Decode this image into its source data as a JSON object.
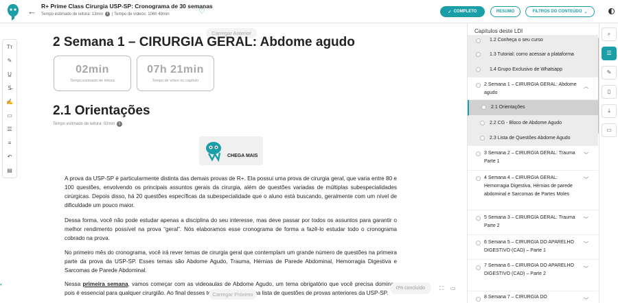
{
  "header": {
    "title": "R+ Prime Class Cirurgia USP-SP: Cronograma de 30 semanas",
    "read_time": "Tempo estimado de leitura: 13min",
    "video_time": "| Tempo de vídeos: 106h 49min",
    "complete_label": "COMPLETO",
    "resumo_label": "RESUMO",
    "filtros_label": "FILTROS DO CONTEÚDO"
  },
  "content": {
    "load_prev": "Carregar Anterior",
    "load_next": "Carregar Próximo",
    "h1": "2 Semana 1 – CIRURGIA GERAL: Abdome agudo",
    "stat1_value": "02min",
    "stat1_label": "Tempo estimado de leitura",
    "stat2_value": "07h 21min",
    "stat2_label": "Tempo de vídeo no capítulo",
    "h2": "2.1 Orientações",
    "h2_readtime": "Tempo estimado de leitura: 02min",
    "banner_text": "CHEGA MAIS",
    "p1": "A prova da USP-SP é particularmente distinta das demais provas de R+. Ela possui uma prova de cirurgia geral, que varia entre 80 e 100 questões, envolvendo os principais assuntos gerais da cirurgia, além de questões variadas de múltiplas subespecialidades cirúrgicas. Depois disso, há 20 questões específicas da subespecialidade que o aluno está buscando, geralmente com um nível de dificuldade um pouco maior.",
    "p2": "Dessa forma, você não pode estudar apenas a disciplina do seu interesse, mas deve passar por todos os assuntos para garantir o melhor rendimento possível na prova “geral”. Nós elaboramos esse cronograma de forma a fazê-lo estudar todo o cronograma cobrado na prova.",
    "p3": "No primeiro mês do cronograma, você irá rever temas de cirurgia geral que contemplam um grande número de questões na primeira parte da prova da USP-SP. Esses temas são Abdome Agudo, Trauma, Hérnias de Parede Abdominal, Hemorragia Digestiva e Sarcomas de Parede Abdominal.",
    "p4_pre": "Nessa ",
    "p4_bold": "primeira semana",
    "p4_post": ", vamos começar com as videoaulas de Abdome Agudo, um tema obrigatório que você precisa dominar, pois é essencial para qualquer cirurgião. Ao final desses temas, você terá uma lista de questões de provas anteriores da USP-SP.",
    "progress": "0% concluído"
  },
  "panel": {
    "title": "Capítulos deste LDI",
    "items": [
      {
        "label": "1.2 Conheça o seu curso"
      },
      {
        "label": "1.3 Tutorial: como acessar a plataforma"
      },
      {
        "label": "1.4 Grupo Exclusivo de Whatsapp"
      },
      {
        "label": "2 Semana 1 – CIRURGIA GERAL: Abdome agudo"
      },
      {
        "label": "2.1 Orientações"
      },
      {
        "label": "2.2 CG - Bloco de Abdome Agudo"
      },
      {
        "label": "2.3 Lista de Questões Abdome Agudo"
      },
      {
        "label": "3 Semana 2 – CIRURGIA GERAL: Trauma Parte 1"
      },
      {
        "label": "4 Semana 4 – CIRURGIA GERAL: Hemorragia Digestiva, Hérnias de parede abdominal e Sarcomas de Partes Moles"
      },
      {
        "label": "5 Semana 3 – CIRURGIA GERAL: Trauma Parte 2"
      },
      {
        "label": "6 Semana 5 – CIRURGIA DO APARELHO DIGESTIVO (CAD) – Parte 1"
      },
      {
        "label": "7 Semana 6 – CIRURGIA DO APARELHO DIGESTIVO (CAD) – Parte 2"
      },
      {
        "label": "8 Semana 7 – CIRURGIA DO"
      }
    ]
  },
  "colors": {
    "accent": "#1a9ea8"
  }
}
